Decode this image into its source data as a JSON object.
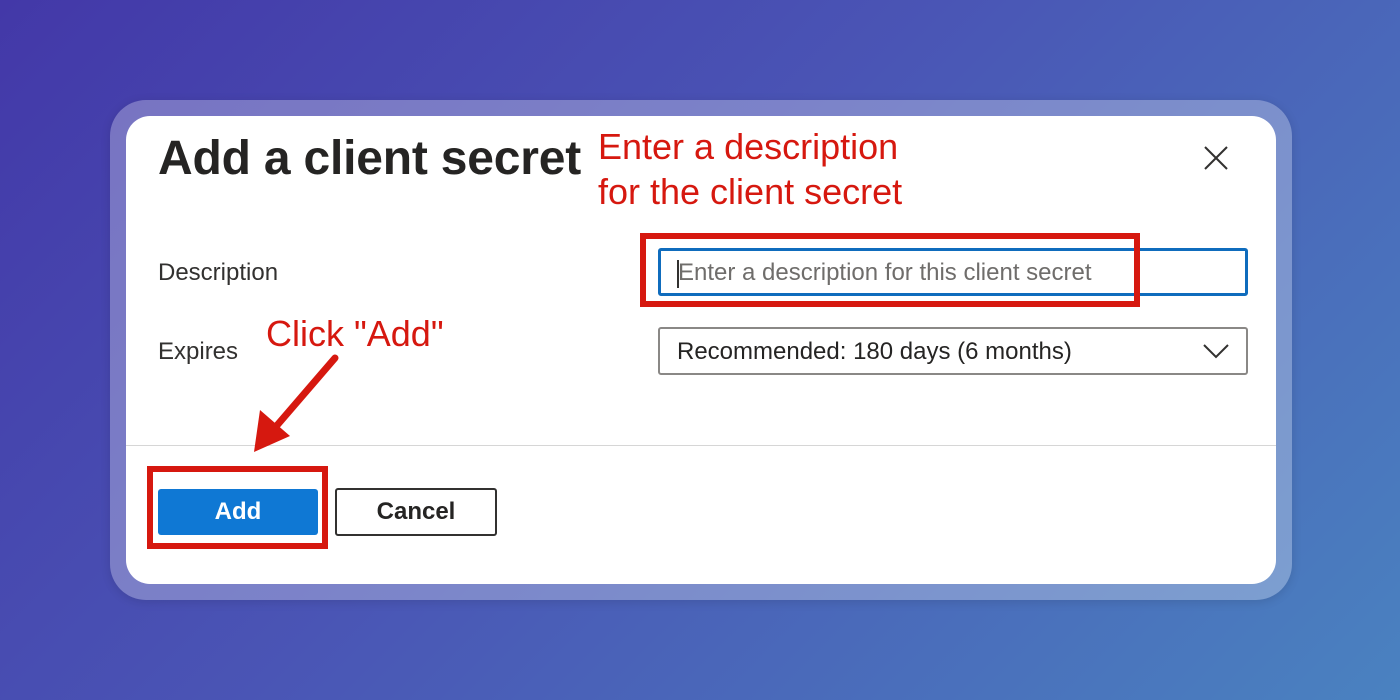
{
  "dialog": {
    "title": "Add a client secret",
    "close_icon": "close-icon",
    "description": {
      "label": "Description",
      "placeholder": "Enter a description for this client secret",
      "value": ""
    },
    "expires": {
      "label": "Expires",
      "selected": "Recommended: 180 days (6 months)",
      "icon": "chevron-down-icon"
    },
    "buttons": {
      "add_label": "Add",
      "cancel_label": "Cancel"
    }
  },
  "annotations": {
    "description_note_line1": "Enter a description",
    "description_note_line2": "for the client secret",
    "add_note": "Click \"Add\"",
    "color": "#d6180f"
  },
  "colors": {
    "primary_button": "#0f78d4",
    "focus_border": "#0f6cbd",
    "background_gradient": [
      "#4338a8",
      "#4a82c0"
    ]
  }
}
